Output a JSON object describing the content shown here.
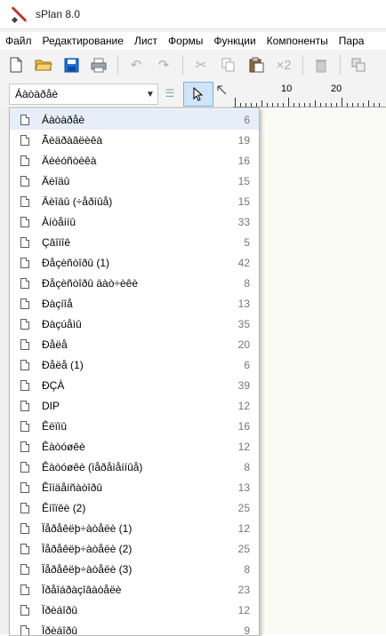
{
  "window": {
    "title": "sPlan 8.0"
  },
  "menu": [
    "Файл",
    "Редактирование",
    "Лист",
    "Формы",
    "Функции",
    "Компоненты",
    "Пара"
  ],
  "toolbar": {
    "icons": [
      "new-file-icon",
      "open-folder-icon",
      "save-icon",
      "print-icon",
      "undo-icon",
      "redo-icon",
      "cut-icon",
      "copy-icon",
      "paste-icon",
      "duplicate-x2-icon",
      "delete-icon",
      "group-icon"
    ],
    "x2_label": "×2"
  },
  "library": {
    "selected": "Áàòàðåè"
  },
  "ruler": {
    "labels": [
      "10",
      "20"
    ]
  },
  "components": [
    {
      "name": "Áàòàðåè",
      "count": "6"
    },
    {
      "name": "Ãèäðàâëèêà",
      "count": "19"
    },
    {
      "name": "Äèéóñòèêà",
      "count": "16"
    },
    {
      "name": "Äèîäû",
      "count": "15"
    },
    {
      "name": "Äèîäû (÷åðíûå)",
      "count": "15"
    },
    {
      "name": "Àíòåííû",
      "count": "33"
    },
    {
      "name": "Çâîíîê",
      "count": "5"
    },
    {
      "name": "Ðåçèñòîðû (1)",
      "count": "42"
    },
    {
      "name": "Ðåçèñòîðû äàò÷èêè",
      "count": "8"
    },
    {
      "name": "Ðàçíîå",
      "count": "13"
    },
    {
      "name": "Ðàçúåìû",
      "count": "35"
    },
    {
      "name": "Ðåëå",
      "count": "20"
    },
    {
      "name": "Ðåëå (1)",
      "count": "6"
    },
    {
      "name": "ÐÇÀ",
      "count": "39"
    },
    {
      "name": "DIP",
      "count": "12"
    },
    {
      "name": "Êëïïû",
      "count": "16"
    },
    {
      "name": "Êàòóøêè",
      "count": "12"
    },
    {
      "name": "Êàòóøêè (ïåðåìåííûå)",
      "count": "8"
    },
    {
      "name": "Êîíäåíñàòîðû",
      "count": "13"
    },
    {
      "name": "Êíîïêè (2)",
      "count": "25"
    },
    {
      "name": "Ïåðåêëþ÷àòåëè (1)",
      "count": "12"
    },
    {
      "name": "Ïåðåêëþ÷àòåëè (2)",
      "count": "25"
    },
    {
      "name": "Ïåðåêëþ÷àòåëè (3)",
      "count": "8"
    },
    {
      "name": "Ïðåîáðàçîâàòåëè",
      "count": "23"
    },
    {
      "name": "Ïðèáîðû",
      "count": "12"
    },
    {
      "name": "Ïðèáîðû",
      "count": "9"
    }
  ]
}
